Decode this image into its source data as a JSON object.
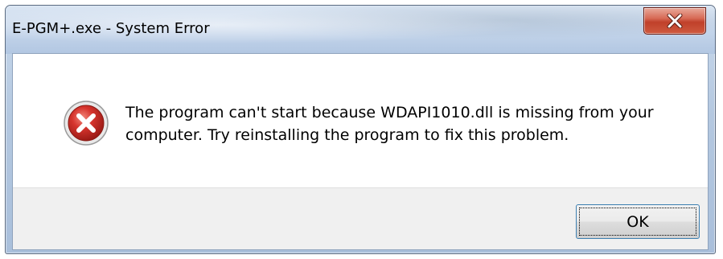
{
  "window": {
    "title": "E-PGM+.exe - System Error"
  },
  "titlebar": {
    "close_icon": "close-icon"
  },
  "dialog": {
    "icon": "error-icon",
    "message": "The program can't start because WDAPI1010.dll is missing from your computer. Try reinstalling the program to fix this problem.",
    "ok_label": "OK"
  },
  "colors": {
    "titlebar": "#c3d4ea",
    "close_button": "#c9452d",
    "error_icon": "#d6342d",
    "button_area": "#f0f0f0",
    "button_border": "#3c7fb1"
  }
}
